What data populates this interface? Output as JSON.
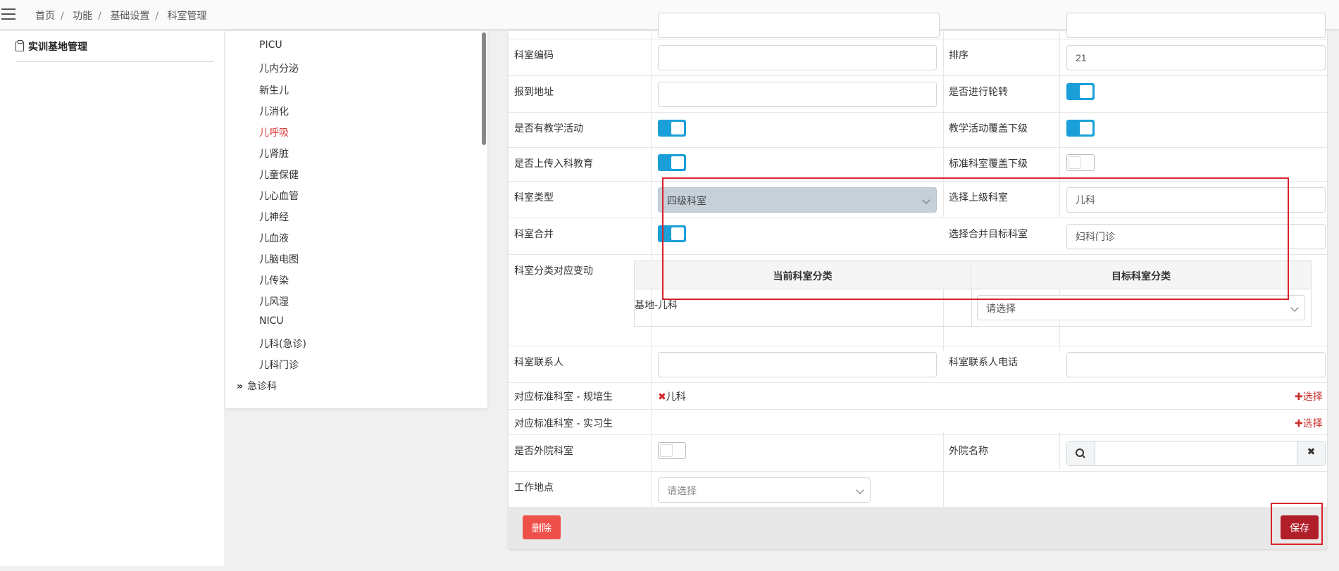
{
  "breadcrumb": [
    "首页",
    "功能",
    "基础设置",
    "科室管理"
  ],
  "sidebar": {
    "title": "实训基地管理"
  },
  "tree": {
    "items": [
      "PICU",
      "儿内分泌",
      "新生儿",
      "儿消化",
      "儿呼吸",
      "儿肾脏",
      "儿童保健",
      "儿心血管",
      "儿神经",
      "儿血液",
      "儿脑电图",
      "儿传染",
      "儿风湿",
      "NICU",
      "儿科(急诊)",
      "儿科门诊"
    ],
    "active_item": "儿呼吸",
    "group": "急诊科"
  },
  "form": {
    "dept_code_label": "科室编码",
    "dept_code_value": "",
    "sort_label": "排序",
    "sort_value": "21",
    "address_label": "报到地址",
    "address_value": "",
    "rotation_label": "是否进行轮转",
    "rotation_on": true,
    "teaching_label": "是否有教学活动",
    "teaching_on": true,
    "teaching_cover_label": "教学活动覆盖下级",
    "teaching_cover_on": true,
    "upload_label": "是否上传入科教育",
    "upload_on": true,
    "std_cover_label": "标准科室覆盖下级",
    "std_cover_on": false,
    "dept_type_label": "科室类型",
    "dept_type_value": "四级科室",
    "parent_label": "选择上级科室",
    "parent_value": "儿科",
    "merge_label": "科室合并",
    "merge_on": true,
    "merge_target_label": "选择合并目标科室",
    "merge_target_value": "妇科门诊",
    "category_change_label": "科室分类对应变动",
    "category_table": {
      "col_current": "当前科室分类",
      "col_target": "目标科室分类",
      "current_value": "基地-儿科",
      "target_value": "请选择"
    },
    "contact_label": "科室联系人",
    "contact_value": "",
    "contact_phone_label": "科室联系人电话",
    "contact_phone_value": "",
    "std_resident_label": "对应标准科室 - 规培生",
    "std_resident_tag": "儿科",
    "std_intern_label": "对应标准科室 - 实习生",
    "select_link": "选择",
    "external_label": "是否外院科室",
    "external_on": false,
    "external_name_label": "外院名称",
    "external_name_value": "",
    "work_place_label": "工作地点",
    "work_place_value": "请选择"
  },
  "buttons": {
    "delete": "删除",
    "save": "保存"
  },
  "colors": {
    "toggle_on": "#1a9fd9",
    "save": "#b01e2a",
    "delete": "#f0504a",
    "highlight": "#d9232d",
    "active_tree": "#d9413a"
  }
}
